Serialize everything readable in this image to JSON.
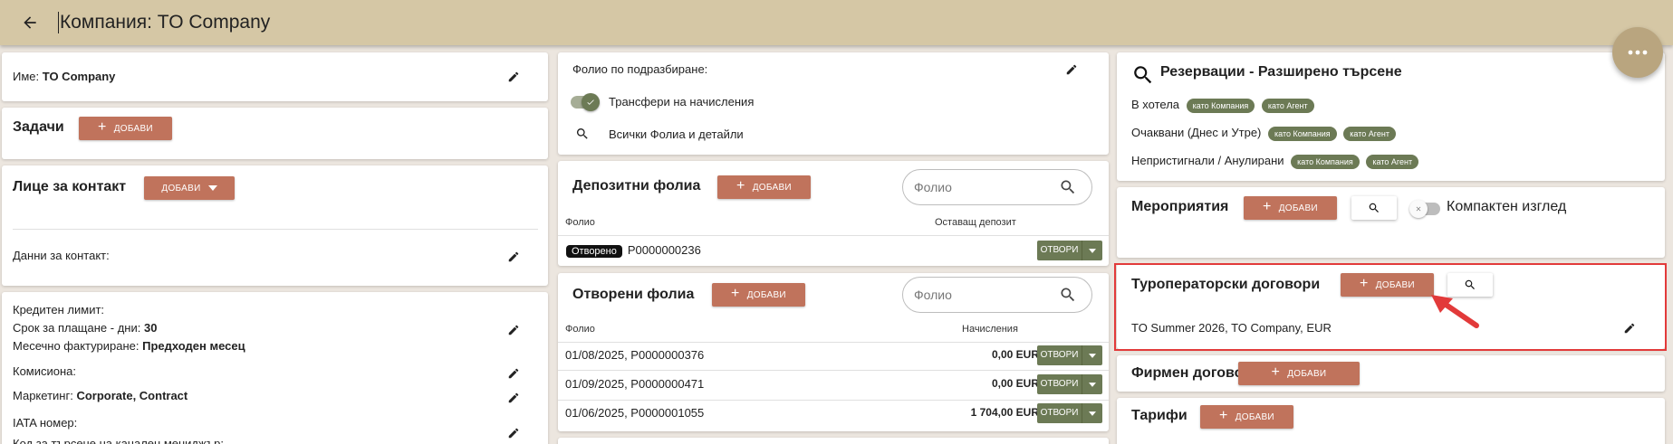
{
  "header": {
    "title": "Компания: TO Company"
  },
  "left": {
    "name_label": "Име:",
    "name_value": "TO Company",
    "tasks_title": "Задачи",
    "add_label": "ДОБАВИ",
    "contact_title": "Лице за контакт",
    "contact_data_label": "Данни за контакт:",
    "credit_limit_label": "Кредитен лимит:",
    "payment_term_label": "Срок за плащане - дни:",
    "payment_term_value": "30",
    "monthly_invoicing_label": "Месечно фактуриране:",
    "monthly_invoicing_value": "Предходен месец",
    "commission_label": "Комисиона:",
    "marketing_label": "Маркетинг:",
    "marketing_value": "Corporate, Contract",
    "iata_label": "IATA номер:",
    "channel_manager_label": "Код за търсене на канален мениджър:"
  },
  "middle": {
    "default_folio_label": "Фолио по подразбиране:",
    "transfers_label": "Трансфери на начисления",
    "all_folios_label": "Всички Фолиа и детайли",
    "deposit_title": "Депозитни фолиа",
    "deposit_search_placeholder": "Фолио",
    "deposit_col_folio": "Фолио",
    "deposit_col_remaining": "Оставащ депозит",
    "deposit_rows": [
      {
        "status": "Отворено",
        "folio": "P0000000236"
      }
    ],
    "open_title": "Отворени фолиа",
    "open_search_placeholder": "Фолио",
    "open_col_folio": "Фолио",
    "open_col_charges": "Начисления",
    "open_rows": [
      {
        "folio": "01/08/2025,  P0000000376",
        "amount": "0,00 EUR"
      },
      {
        "folio": "01/09/2025,  P0000000471",
        "amount": "0,00 EUR"
      },
      {
        "folio": "01/06/2025,  P0000001055",
        "amount": "1 704,00 EUR"
      }
    ],
    "open_button": "ОТВОРИ"
  },
  "right": {
    "reservations_title": "Резервации - Разширено търсене",
    "in_hotel_label": "В хотела",
    "expected_label": "Очаквани (Днес и Утре)",
    "noshow_label": "Непристигнали / Анулирани",
    "chip_company": "като Компания",
    "chip_agent": "като Агент",
    "events_title": "Мероприятия",
    "compact_view_label": "Компактен изглед",
    "tour_title": "Туроператорски договори",
    "tour_contract": "TO Summer 2026, TO Company, EUR",
    "corporate_title": "Фирмен договор",
    "rates_title": "Тарифи"
  },
  "colors": {
    "header_bg": "#d5c7a5",
    "add_button": "#c0735c",
    "chip_bg": "#6c7a55",
    "highlight": "#e23a3a"
  }
}
